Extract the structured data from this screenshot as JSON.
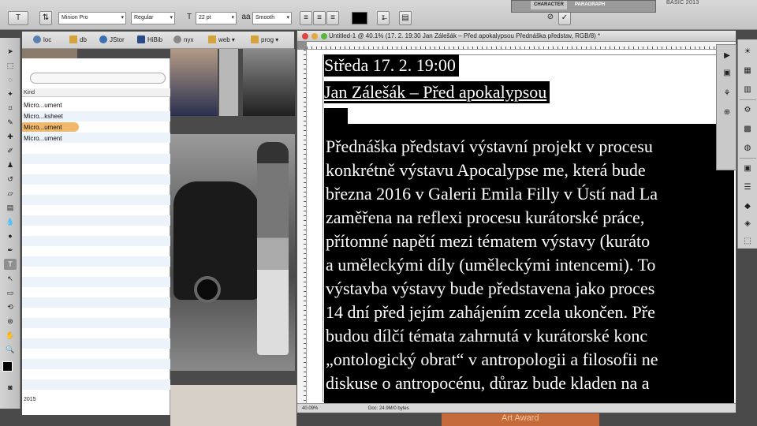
{
  "options_bar": {
    "font_family": "Minion Pro",
    "font_style": "Regular",
    "font_size": "22 pt",
    "antialias": "Smooth",
    "text_tool_glyph": "T",
    "panel_tabs": [
      "CHARACTER",
      "PARAGRAPH"
    ],
    "workspace": "BASIC 2013"
  },
  "bookmarks": [
    "loc",
    "db",
    "JStor",
    "HiBib",
    "nyx",
    "web",
    "prog"
  ],
  "finder": {
    "column_header": "Kind",
    "rows": [
      "Micro...ument",
      "Micro...ksheet",
      "Micro...ument",
      "Micro...ument"
    ],
    "selected_index": 2,
    "footer": "2015"
  },
  "document": {
    "title": "Untitled-1 @ 40.1% (17. 2. 19:30 Jan Zálešák – Před apokalypsou  Přednáška představ, RGB/8) *",
    "heading_lines": [
      "Středa 17. 2. 19:00",
      "Jan Zálešák – Před apokalypsou"
    ],
    "body_lines": [
      "Přednáška představí výstavní projekt v procesu",
      "konkrétně výstavu Apocalypse me, která bude",
      "března 2016 v Galerii Emila Filly v Ústí nad La",
      "zaměřena na reflexi procesu kurátorské práce,",
      "přítomné napětí mezi tématem výstavy (kuráto",
      "a uměleckými díly (uměleckými intencemi). To",
      "výstavba výstavy bude představena jako proces",
      "14 dní před jejím zahájením zcela ukončen. Pře",
      "budou dílčí témata zahrnutá v kurátorské konc",
      "„ontologický obrat“ v antropologii a filosofii ne",
      "diskuse o antropocénu, důraz bude kladen na a"
    ],
    "zoom": "40.09%",
    "doc_size": "Doc: 24.9M/0 bytes"
  },
  "right_panel_icons": [
    "sun-icon",
    "layers-icon",
    "channels-icon",
    "paths-icon",
    "swatches-icon",
    "adjust-icon",
    "styles-icon",
    "history-icon",
    "actions-icon",
    "3d-icon",
    "cube-icon",
    "transform-icon"
  ],
  "bg_text": "Art Award"
}
